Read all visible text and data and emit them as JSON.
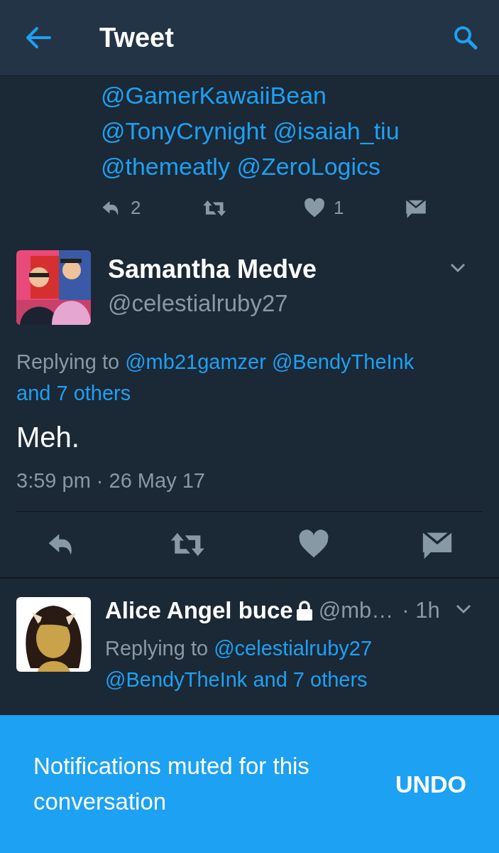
{
  "header": {
    "title": "Tweet"
  },
  "thread_tail": {
    "mention_lines": [
      [
        "@GamerKawaiiBean"
      ],
      [
        "@TonyCrynight",
        "@isaiah_tiu"
      ],
      [
        "@themeatly",
        "@ZeroLogics"
      ]
    ],
    "actions": [
      {
        "kind": "reply",
        "count": "2"
      },
      {
        "kind": "retweet"
      },
      {
        "kind": "like",
        "count": "1"
      },
      {
        "kind": "message"
      }
    ]
  },
  "focused_tweet": {
    "avatar": {
      "kind": "picture"
    },
    "name": "Samantha Medve",
    "handle": "@celestialruby27",
    "replying_label": "Replying to",
    "replying_targets": [
      "@mb21gamzer",
      "@BendyTheInk",
      "and 7 others"
    ],
    "text": "Meh.",
    "timestamp": "3:59 pm · 26 May 17",
    "actions": [
      {
        "kind": "reply"
      },
      {
        "kind": "retweet"
      },
      {
        "kind": "like"
      },
      {
        "kind": "message"
      }
    ]
  },
  "reply": {
    "avatar": {
      "kind": "picture"
    },
    "name": "Alice Angel buce",
    "protected": true,
    "handle": "@mb…",
    "time": "· 1h",
    "replying_label": "Replying to",
    "replying_targets": [
      "@celestialruby27",
      "@BendyTheInk",
      "and 7 others"
    ]
  },
  "snackbar": {
    "message": "Notifications muted for this conversation",
    "action": "UNDO"
  }
}
